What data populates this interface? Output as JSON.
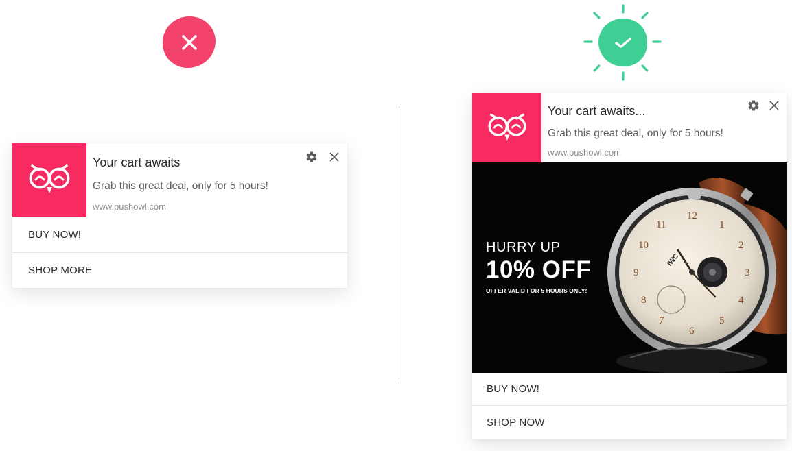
{
  "colors": {
    "brand_pink": "#f72a62",
    "bad_red": "#f2416a",
    "good_green": "#3ecf95",
    "divider": "#6b6b6b"
  },
  "status_marks": {
    "bad": {
      "icon": "cross-icon",
      "color": "#f2416a"
    },
    "good": {
      "icon": "checkmark-icon",
      "color": "#3ecf95"
    }
  },
  "left_notification": {
    "logo_icon": "owl-logo-icon",
    "title": "Your cart awaits",
    "message": "Grab this great deal, only for 5 hours!",
    "site": "www.pushowl.com",
    "settings_icon": "gear-icon",
    "close_icon": "close-icon",
    "actions": [
      "BUY NOW!",
      "SHOP MORE"
    ]
  },
  "right_notification": {
    "logo_icon": "owl-logo-icon",
    "title": "Your cart awaits...",
    "message": "Grab this great deal, only for 5 hours!",
    "site": "www.pushowl.com",
    "settings_icon": "gear-icon",
    "close_icon": "close-icon",
    "banner": {
      "line1": "HURRY UP",
      "line2": "10% OFF",
      "line3": "OFFER VALID FOR 5 HOURS ONLY!",
      "image": "wristwatch-image"
    },
    "actions": [
      "BUY NOW!",
      "SHOP NOW"
    ]
  }
}
